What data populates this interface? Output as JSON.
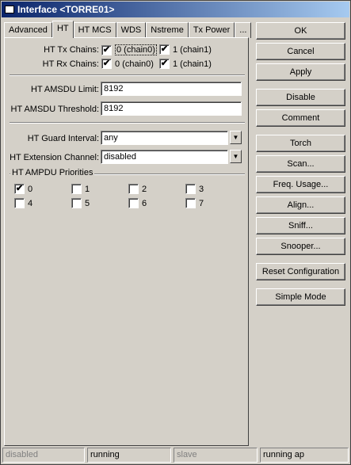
{
  "window": {
    "title": "Interface <TORRE01>"
  },
  "tabs": [
    {
      "label": "Advanced"
    },
    {
      "label": "HT"
    },
    {
      "label": "HT MCS"
    },
    {
      "label": "WDS"
    },
    {
      "label": "Nstreme"
    },
    {
      "label": "Tx Power"
    },
    {
      "label": "..."
    }
  ],
  "active_tab": "HT",
  "ht": {
    "tx_chains_label": "HT Tx Chains:",
    "rx_chains_label": "HT Rx Chains:",
    "tx_chain0": {
      "label": "0 (chain0)",
      "checked": true
    },
    "tx_chain1": {
      "label": "1 (chain1)",
      "checked": true
    },
    "rx_chain0": {
      "label": "0 (chain0)",
      "checked": true
    },
    "rx_chain1": {
      "label": "1 (chain1)",
      "checked": true
    },
    "amsdu_limit_label": "HT AMSDU Limit:",
    "amsdu_limit_value": "8192",
    "amsdu_threshold_label": "HT AMSDU Threshold:",
    "amsdu_threshold_value": "8192",
    "guard_interval_label": "HT Guard Interval:",
    "guard_interval_value": "any",
    "extension_channel_label": "HT Extension Channel:",
    "extension_channel_value": "disabled",
    "ampdu_title": "HT AMPDU Priorities",
    "ampdu_priorities": [
      {
        "label": "0",
        "checked": true
      },
      {
        "label": "1",
        "checked": false
      },
      {
        "label": "2",
        "checked": false
      },
      {
        "label": "3",
        "checked": false
      },
      {
        "label": "4",
        "checked": false
      },
      {
        "label": "5",
        "checked": false
      },
      {
        "label": "6",
        "checked": false
      },
      {
        "label": "7",
        "checked": false
      }
    ]
  },
  "buttons": {
    "ok": "OK",
    "cancel": "Cancel",
    "apply": "Apply",
    "disable": "Disable",
    "comment": "Comment",
    "torch": "Torch",
    "scan": "Scan...",
    "freq_usage": "Freq. Usage...",
    "align": "Align...",
    "sniff": "Sniff...",
    "snooper": "Snooper...",
    "reset_configuration": "Reset Configuration",
    "simple_mode": "Simple Mode"
  },
  "status": {
    "cell1": "disabled",
    "cell2": "running",
    "cell3": "slave",
    "cell4": "running ap"
  },
  "icons": {
    "check": "✔",
    "dropdown": "▼"
  }
}
